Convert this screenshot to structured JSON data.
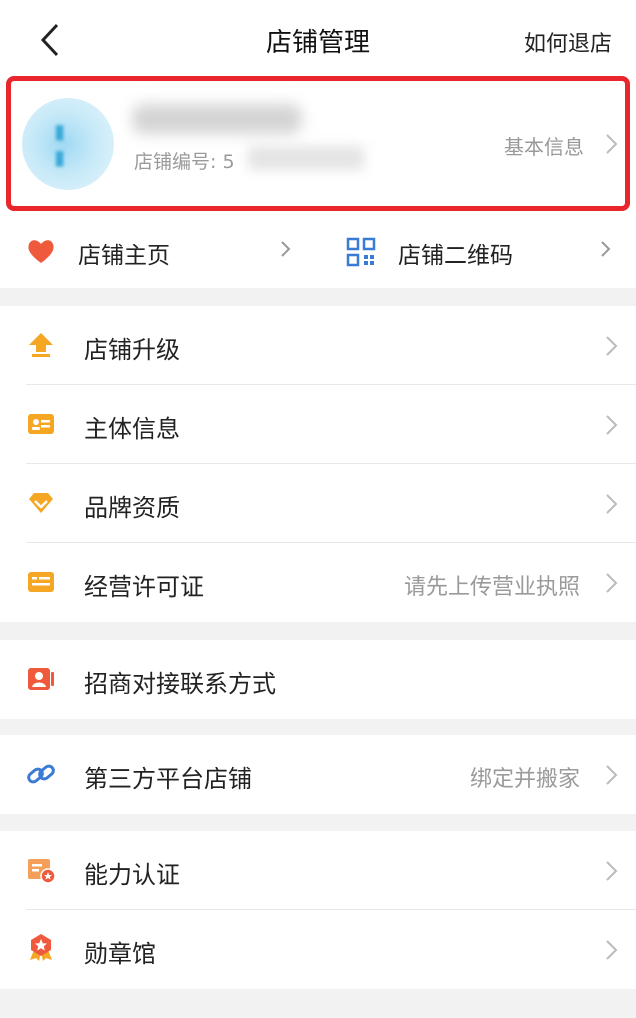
{
  "header": {
    "title": "店铺管理",
    "right_action": "如何退店"
  },
  "store": {
    "number_prefix": "店铺编号: 5",
    "basic_info_label": "基本信息"
  },
  "quick_links": [
    {
      "label": "店铺主页",
      "icon": "heart-icon"
    },
    {
      "label": "店铺二维码",
      "icon": "qr-code-icon"
    }
  ],
  "sections": [
    [
      {
        "label": "店铺升级",
        "icon": "upgrade-icon",
        "value": ""
      },
      {
        "label": "主体信息",
        "icon": "id-card-icon",
        "value": ""
      },
      {
        "label": "品牌资质",
        "icon": "brand-diamond-icon",
        "value": ""
      },
      {
        "label": "经营许可证",
        "icon": "license-icon",
        "value": "请先上传营业执照"
      }
    ],
    [
      {
        "label": "招商对接联系方式",
        "icon": "contact-card-icon",
        "value": ""
      }
    ],
    [
      {
        "label": "第三方平台店铺",
        "icon": "link-icon",
        "value": "绑定并搬家"
      }
    ],
    [
      {
        "label": "能力认证",
        "icon": "certificate-icon",
        "value": ""
      },
      {
        "label": "勋章馆",
        "icon": "medal-icon",
        "value": ""
      }
    ]
  ],
  "colors": {
    "highlight_border": "#e8262b",
    "icon_orange": "#f5a623",
    "icon_red": "#f05a3c",
    "icon_blue": "#3a7bd5"
  }
}
